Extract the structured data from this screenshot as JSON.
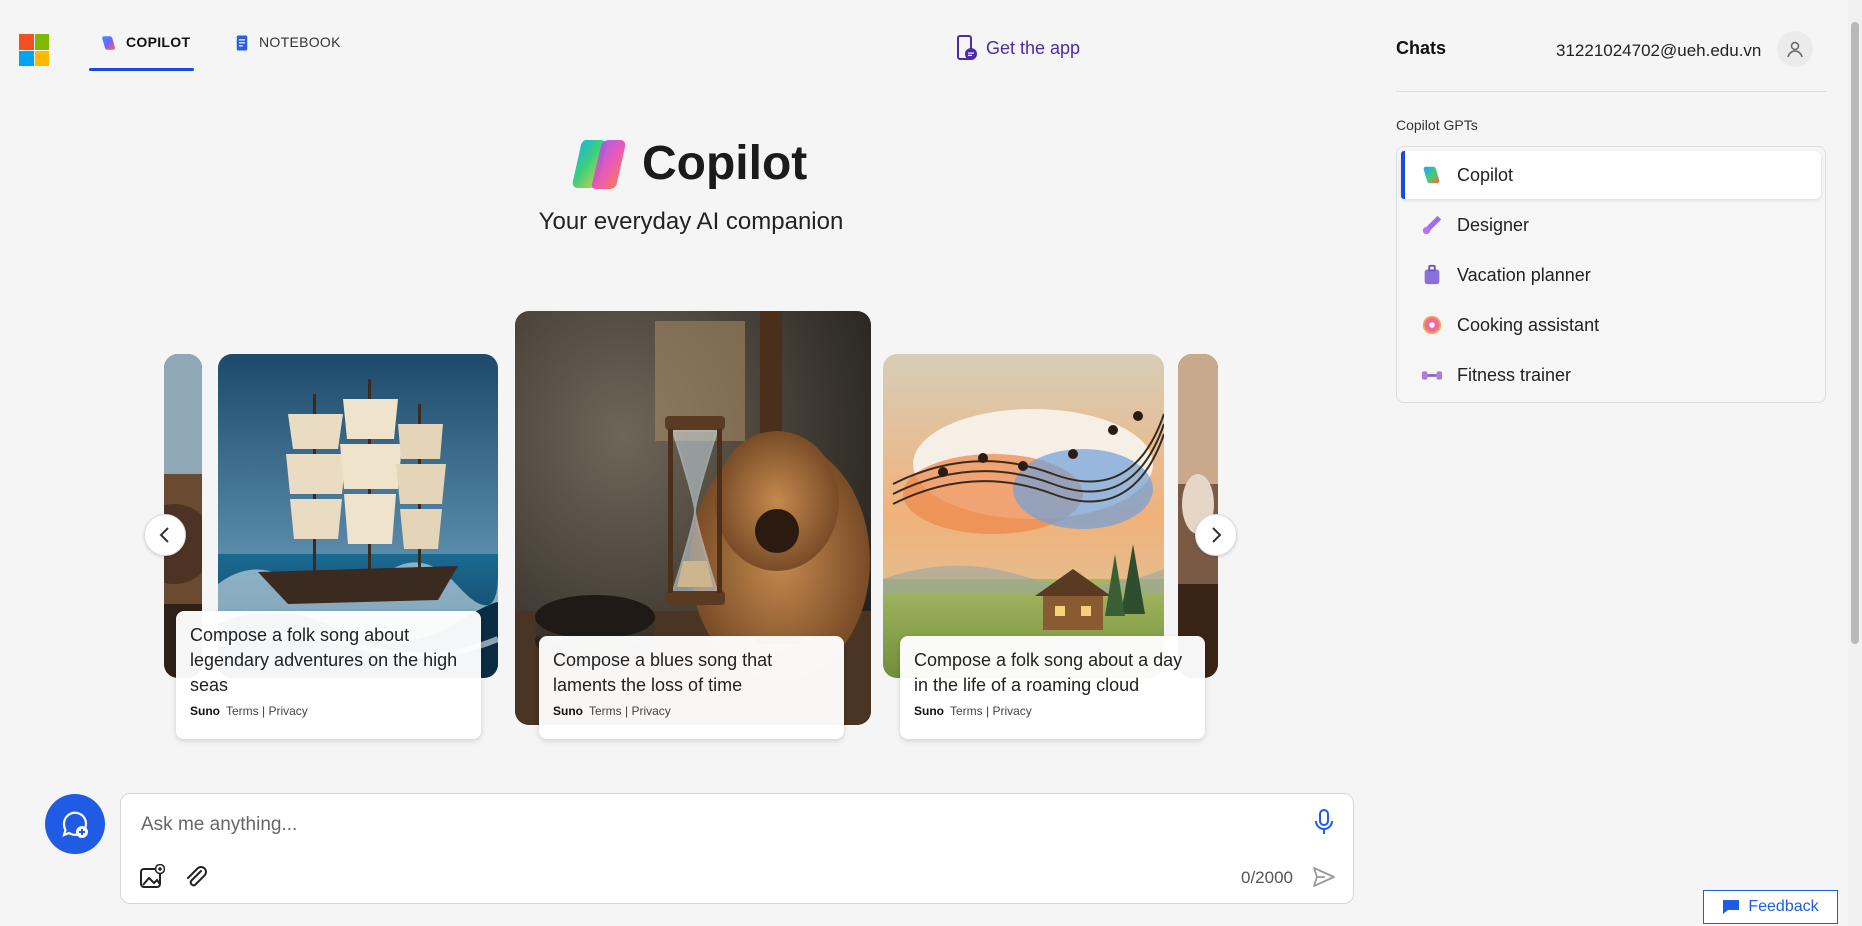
{
  "header": {
    "tabs": [
      {
        "label": "COPILOT",
        "icon": "copilot-icon",
        "active": true
      },
      {
        "label": "NOTEBOOK",
        "icon": "notebook-icon",
        "active": false
      }
    ],
    "get_app": "Get the app"
  },
  "hero": {
    "title": "Copilot",
    "subtitle": "Your everyday AI companion"
  },
  "carousel": {
    "cards": [
      {
        "text": "Compose a folk song about legendary adventures on the high seas",
        "brand": "Suno",
        "links": "Terms | Privacy",
        "image": "sailing-ship"
      },
      {
        "text": "Compose a blues song that laments the loss of time",
        "brand": "Suno",
        "links": "Terms | Privacy",
        "image": "guitar-hourglass"
      },
      {
        "text": "Compose a folk song about a day in the life of a roaming cloud",
        "brand": "Suno",
        "links": "Terms | Privacy",
        "image": "music-cloud-landscape"
      }
    ]
  },
  "input": {
    "placeholder": "Ask me anything...",
    "value": "",
    "counter": "0/2000"
  },
  "sidebar": {
    "title": "Chats",
    "email": "31221024702@ueh.edu.vn",
    "gpts_heading": "Copilot GPTs",
    "gpts": [
      {
        "label": "Copilot",
        "icon": "copilot-icon",
        "active": true
      },
      {
        "label": "Designer",
        "icon": "designer-icon",
        "active": false
      },
      {
        "label": "Vacation planner",
        "icon": "suitcase-icon",
        "active": false
      },
      {
        "label": "Cooking assistant",
        "icon": "donut-icon",
        "active": false
      },
      {
        "label": "Fitness trainer",
        "icon": "dumbbell-icon",
        "active": false
      }
    ]
  },
  "feedback": "Feedback",
  "colors": {
    "accent": "#174ae4",
    "get_app": "#4b2ca8",
    "background": "#f5f5f5"
  }
}
